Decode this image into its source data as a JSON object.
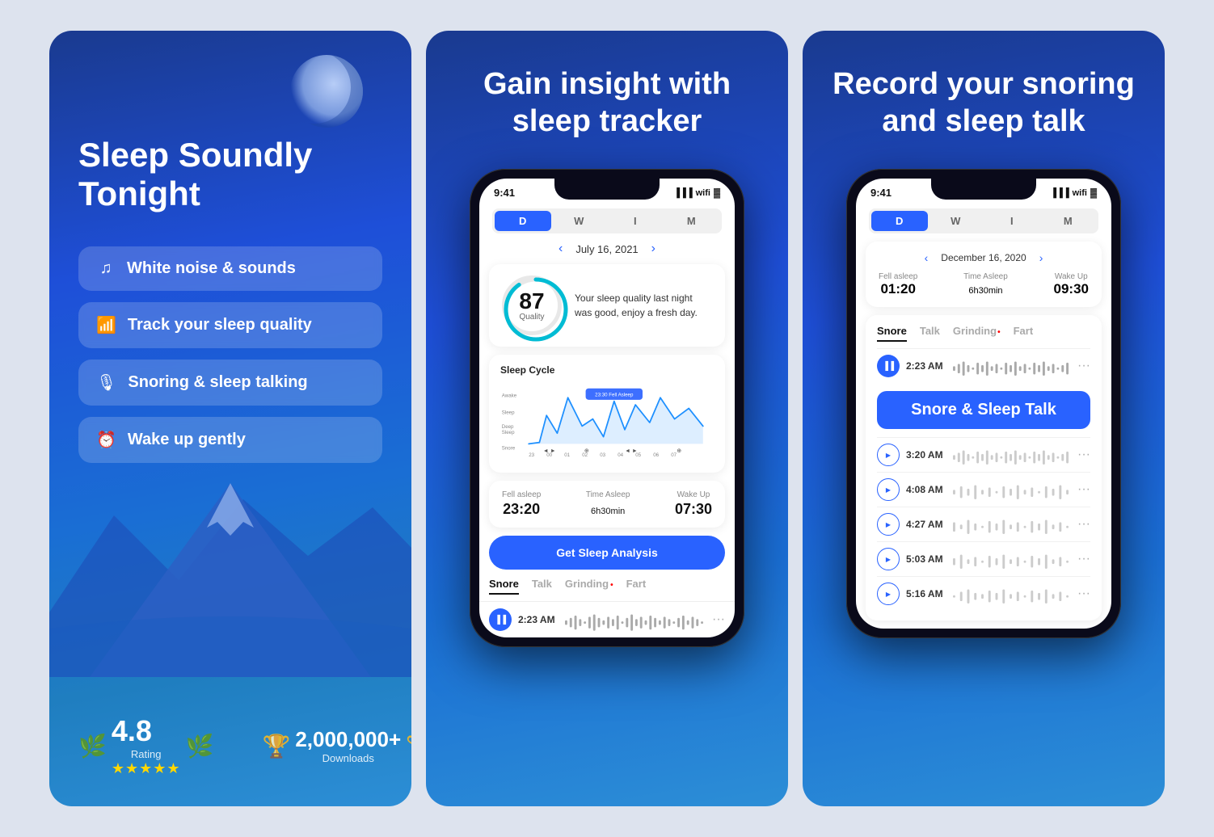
{
  "panels": {
    "left": {
      "title": "Sleep Soundly Tonight",
      "features": [
        {
          "id": "white-noise",
          "icon": "♪",
          "label": "White noise & sounds"
        },
        {
          "id": "sleep-quality",
          "icon": "📊",
          "label": "Track your sleep quality"
        },
        {
          "id": "snoring",
          "icon": "🎙",
          "label": "Snoring & sleep talking"
        },
        {
          "id": "wake-up",
          "icon": "⏰",
          "label": "Wake up gently"
        }
      ],
      "rating": "4.8",
      "rating_label": "Rating",
      "downloads": "2,000,000+",
      "downloads_label": "Downloads"
    },
    "middle": {
      "title": "Gain insight with sleep tracker",
      "phone": {
        "time": "9:41",
        "tabs": [
          "D",
          "W",
          "I",
          "M"
        ],
        "active_tab": "D",
        "date": "July 16, 2021",
        "quality_score": "87",
        "quality_label": "Quality",
        "quality_text": "Your sleep quality last night was good, enjoy a fresh day.",
        "chart_title": "Sleep Cycle",
        "chart_labels": [
          "Awake",
          "Sleep",
          "Deep Sleep",
          "Snore"
        ],
        "chart_times": [
          "23",
          "00",
          "01",
          "02",
          "03",
          "04",
          "05",
          "06",
          "07"
        ],
        "fell_asleep_label": "Fell asleep",
        "fell_asleep_val": "23:20",
        "time_asleep_label": "Time Asleep",
        "time_asleep_val": "6h",
        "time_asleep_min": "30min",
        "wake_up_label": "Wake Up",
        "wake_up_val": "07:30",
        "analysis_btn": "Get Sleep Analysis",
        "sound_tabs": [
          "Snore",
          "Talk",
          "Grinding",
          "Fart"
        ],
        "active_sound_tab": "Snore",
        "recordings": [
          {
            "time": "2:23 AM",
            "icon": "bars"
          }
        ]
      }
    },
    "right": {
      "title": "Record your snoring and sleep talk",
      "phone": {
        "time": "9:41",
        "tabs": [
          "D",
          "W",
          "I",
          "M"
        ],
        "active_tab": "D",
        "date": "December 16, 2020",
        "fell_asleep_label": "Fell asleep",
        "fell_asleep_val": "01:20",
        "time_asleep_label": "Time Asleep",
        "time_asleep_val": "6h",
        "time_asleep_min": "30min",
        "wake_up_label": "Wake Up",
        "wake_up_val": "09:30",
        "sound_tabs": [
          "Snore",
          "Talk",
          "Grinding",
          "Fart"
        ],
        "active_sound_tab": "Snore",
        "highlight_text": "Snore & Sleep Talk",
        "recordings": [
          {
            "time": "2:23 AM",
            "type": "bars"
          },
          {
            "time": "3:20 AM",
            "type": "play"
          },
          {
            "time": "4:08 AM",
            "type": "play"
          },
          {
            "time": "4:27 AM",
            "type": "play"
          },
          {
            "time": "5:03 AM",
            "type": "play"
          },
          {
            "time": "5:16 AM",
            "type": "play"
          }
        ]
      }
    }
  }
}
